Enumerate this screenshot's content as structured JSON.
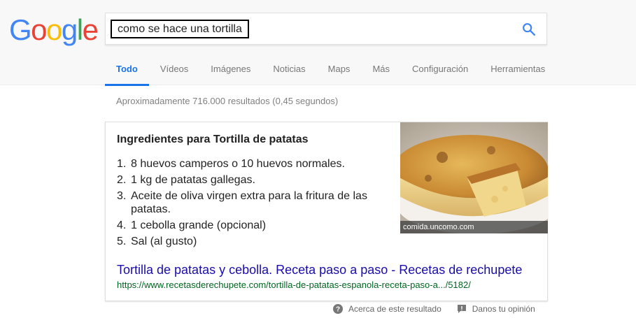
{
  "logo": {
    "letters": [
      "G",
      "o",
      "o",
      "g",
      "l",
      "e"
    ],
    "colors": [
      "#4285F4",
      "#EA4335",
      "#FBBC05",
      "#4285F4",
      "#34A853",
      "#EA4335"
    ]
  },
  "search": {
    "query": "como se hace una tortilla",
    "icon": "search-icon"
  },
  "tabs": [
    {
      "label": "Todo",
      "active": true
    },
    {
      "label": "Vídeos"
    },
    {
      "label": "Imágenes"
    },
    {
      "label": "Noticias"
    },
    {
      "label": "Maps"
    },
    {
      "label": "Más"
    },
    {
      "label": "Configuración"
    },
    {
      "label": "Herramientas"
    }
  ],
  "stats": "Aproximadamente 716.000 resultados (0,45 segundos)",
  "snippet": {
    "title": "Ingredientes para Tortilla de patatas",
    "ingredients": [
      {
        "num": "1.",
        "text": "8 huevos camperos o 10 huevos normales."
      },
      {
        "num": "2.",
        "text": "1 kg de patatas gallegas."
      },
      {
        "num": "3.",
        "text": "Aceite de oliva virgen extra para la fritura de las patatas."
      },
      {
        "num": "4.",
        "text": "1 cebolla grande (opcional)"
      },
      {
        "num": "5.",
        "text": "Sal (al gusto)"
      }
    ],
    "image_credit": "comida.uncomo.com",
    "link_text": "Tortilla de patatas y cebolla. Receta paso a paso - Recetas de rechupete",
    "url": "https://www.recetasderechupete.com/tortilla-de-patatas-espanola-receta-paso-a.../5182/"
  },
  "footer": {
    "about": "Acerca de este resultado",
    "feedback": "Danos tu opinión"
  },
  "colors": {
    "accent": "#1a73e8",
    "link": "#1a0dab",
    "url": "#006621"
  }
}
